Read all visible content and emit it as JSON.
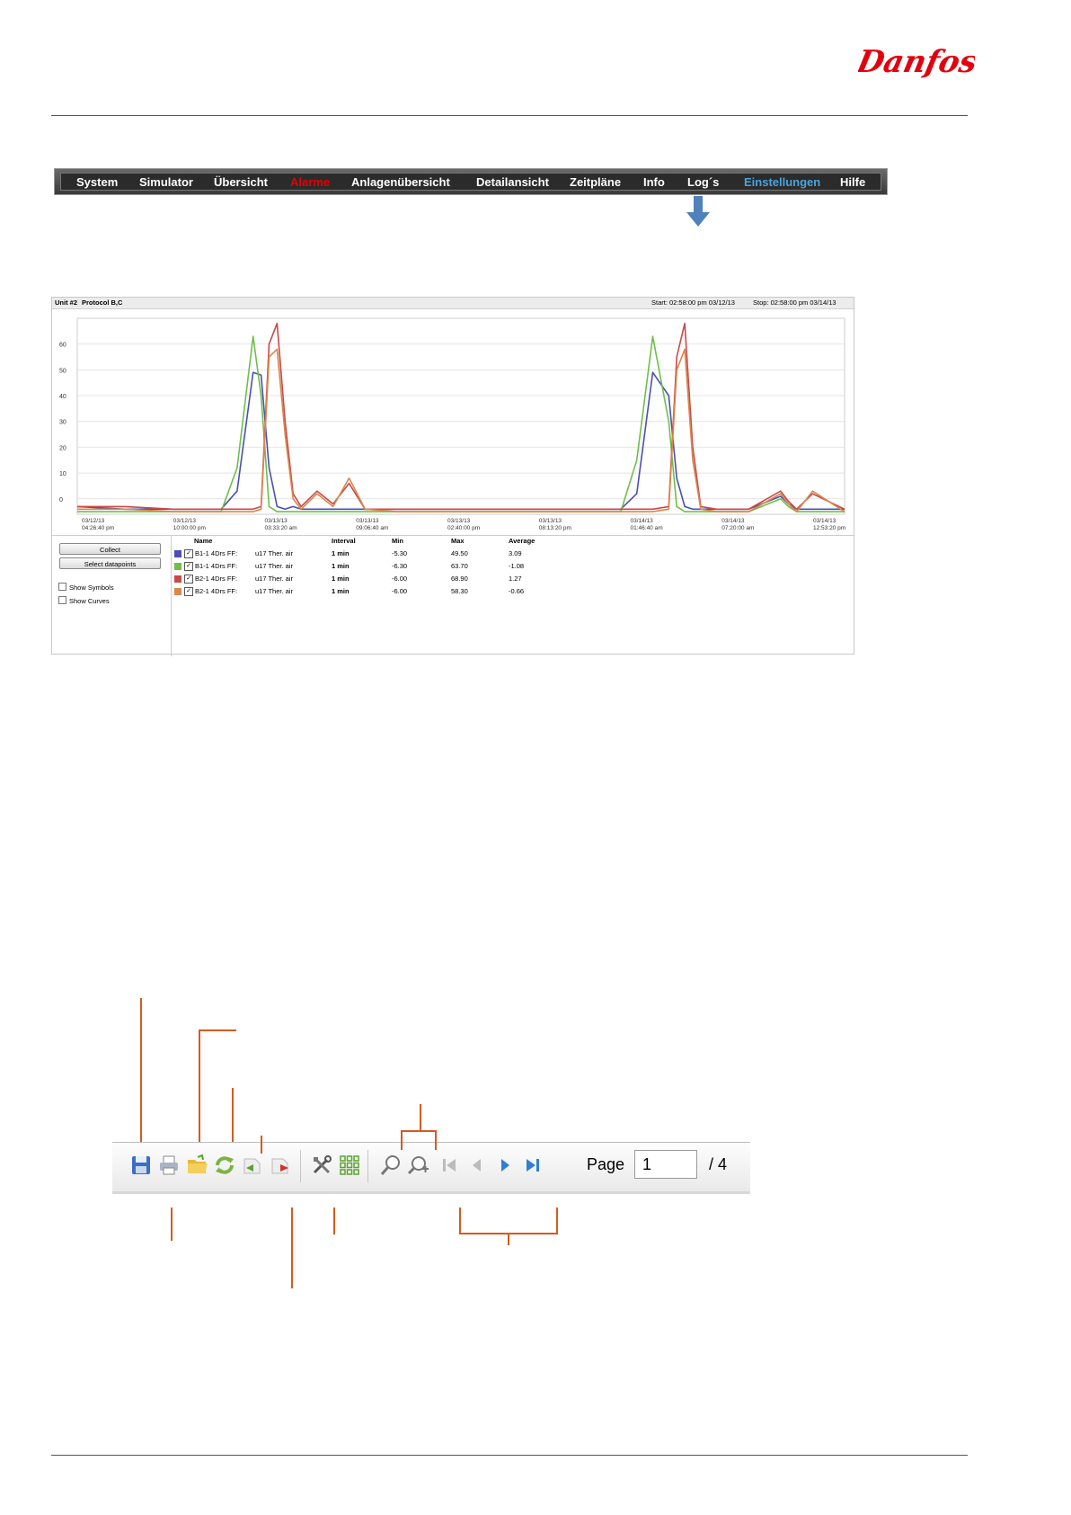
{
  "brand": {
    "logo_text": "Danfoss",
    "color": "#e2000f"
  },
  "nav": {
    "items": [
      "System",
      "Simulator",
      "Übersicht",
      "Alarme",
      "Anlagenübersicht",
      "Detailansicht",
      "Zeitpläne",
      "Info",
      "Log´s",
      "Einstellungen",
      "Hilfe"
    ],
    "alarm_color": "#e60000",
    "active_color": "#4aa3df"
  },
  "log": {
    "unit": "Unit #2",
    "protocol": "Protocol B,C",
    "start": "Start: 02:58:00 pm 03/12/13",
    "stop": "Stop: 02:58:00 pm 03/14/13",
    "buttons": {
      "collect": "Collect",
      "select": "Select datapoints"
    },
    "checks": {
      "symbols": "Show Symbols",
      "curves": "Show Curves"
    },
    "headers": {
      "name": "Name",
      "interval": "Interval",
      "min": "Min",
      "max": "Max",
      "average": "Average"
    },
    "rows": [
      {
        "name": "B1-1 4Drs FF:",
        "param": "u17 Ther. air",
        "interval": "1 min",
        "min": "-5.30",
        "max": "49.50",
        "avg": "3.09",
        "color": "#4a4fb5"
      },
      {
        "name": "B1-1 4Drs FF:",
        "param": "u17 Ther. air",
        "interval": "1 min",
        "min": "-6.30",
        "max": "63.70",
        "avg": "-1.08",
        "color": "#6fbf4a"
      },
      {
        "name": "B2-1 4Drs FF:",
        "param": "u17 Ther. air",
        "interval": "1 min",
        "min": "-6.00",
        "max": "68.90",
        "avg": "1.27",
        "color": "#c94a4a"
      },
      {
        "name": "B2-1 4Drs FF:",
        "param": "u17 Ther. air",
        "interval": "1 min",
        "min": "-6.00",
        "max": "58.30",
        "avg": "-0.66",
        "color": "#d9874a"
      }
    ]
  },
  "chart_data": {
    "type": "line",
    "title": "",
    "ylim": [
      -6,
      70
    ],
    "yticks": [
      0,
      10,
      20,
      30,
      40,
      50,
      60
    ],
    "xticks": [
      {
        "date": "03/12/13",
        "time": "04:26:40 pm"
      },
      {
        "date": "03/12/13",
        "time": "10:00:00 pm"
      },
      {
        "date": "03/13/13",
        "time": "03:33:20 am"
      },
      {
        "date": "03/13/13",
        "time": "09:06:40 am"
      },
      {
        "date": "03/13/13",
        "time": "02:40:00 pm"
      },
      {
        "date": "03/13/13",
        "time": "08:13:20 pm"
      },
      {
        "date": "03/14/13",
        "time": "01:46:40 am"
      },
      {
        "date": "03/14/13",
        "time": "07:20:00 am"
      },
      {
        "date": "03/14/13",
        "time": "12:53:20 pm"
      }
    ],
    "x_hours": [
      0,
      3,
      6,
      8,
      9,
      10,
      11,
      11.5,
      12,
      12.5,
      13,
      13.5,
      14,
      15,
      16,
      17,
      18,
      20,
      24,
      28,
      32,
      34,
      35,
      36,
      37,
      37.5,
      38,
      38.5,
      39,
      40,
      42,
      44,
      44.5,
      45,
      46,
      48
    ],
    "series": [
      {
        "name": "B1-1 4Drs FF: u17 Ther. air",
        "color": "#4a4fb5",
        "values": [
          -3,
          -4,
          -4,
          -4,
          -4,
          3,
          49,
          48,
          12,
          -3,
          -4,
          -3,
          -4,
          -4,
          -4,
          -4,
          -4,
          -4,
          -4,
          -4,
          -4,
          -4,
          2,
          49,
          40,
          8,
          -3,
          -4,
          -4,
          -4,
          -4,
          1,
          -2,
          -4,
          -4,
          -4
        ]
      },
      {
        "name": "B1-1 4Drs FF: u17 Ther. air",
        "color": "#6fbf4a",
        "values": [
          -5,
          -5,
          -5,
          -5,
          -5,
          12,
          63,
          40,
          -3,
          -5,
          -5,
          -5,
          -5,
          -5,
          -5,
          -5,
          -5,
          -5,
          -5,
          -5,
          -5,
          -5,
          15,
          63,
          30,
          -3,
          -5,
          -5,
          -5,
          -5,
          -5,
          0,
          -3,
          -5,
          -5,
          -5
        ]
      },
      {
        "name": "B2-1 4Drs FF: u17 Ther. air",
        "color": "#c94a4a",
        "values": [
          -3,
          -3,
          -4,
          -4,
          -4,
          -4,
          -4,
          -3,
          60,
          68,
          30,
          2,
          -3,
          3,
          -2,
          6,
          -4,
          -4,
          -4,
          -4,
          -4,
          -4,
          -4,
          -4,
          -3,
          55,
          68,
          20,
          -3,
          -4,
          -4,
          3,
          -1,
          -4,
          2,
          -4
        ]
      },
      {
        "name": "B2-1 4Drs FF: u17 Ther. air",
        "color": "#d9874a",
        "values": [
          -4,
          -4,
          -5,
          -5,
          -5,
          -5,
          -5,
          -4,
          55,
          58,
          25,
          0,
          -4,
          2,
          -3,
          8,
          -4,
          -5,
          -5,
          -5,
          -5,
          -5,
          -5,
          -5,
          -4,
          50,
          58,
          15,
          -4,
          -5,
          -5,
          2,
          -2,
          -5,
          3,
          -5
        ]
      }
    ]
  },
  "toolbar": {
    "page_label": "Page",
    "page_value": "1",
    "page_total": "/ 4"
  }
}
